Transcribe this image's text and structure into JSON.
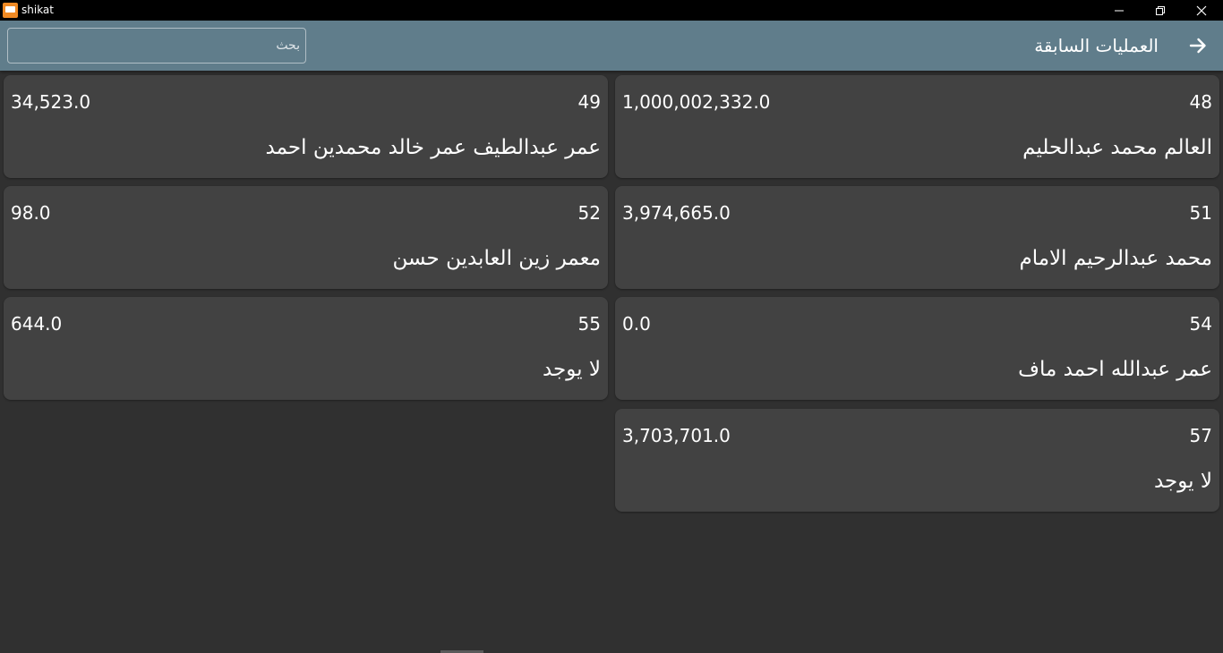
{
  "window": {
    "title": "shikat",
    "controls": [
      "minimize",
      "restore",
      "close"
    ]
  },
  "appbar": {
    "title": "العمليات السابقة",
    "back_icon": "arrow-right-icon",
    "search": {
      "placeholder": "بحث",
      "value": ""
    }
  },
  "colors": {
    "appbar": "#607d8b",
    "background": "#303030",
    "card": "#424242",
    "titlebar": "#000000"
  },
  "records": [
    {
      "id": "48",
      "amount": "1,000,002,332.0",
      "name": "العالم محمد عبدالحليم"
    },
    {
      "id": "49",
      "amount": "34,523.0",
      "name": "عمر عبدالطيف عمر خالد محمدين احمد"
    },
    {
      "id": "51",
      "amount": "3,974,665.0",
      "name": "محمد عبدالرحيم الامام"
    },
    {
      "id": "52",
      "amount": "98.0",
      "name": "معمر زين العابدين حسن"
    },
    {
      "id": "54",
      "amount": "0.0",
      "name": "عمر عبدالله احمد ماف"
    },
    {
      "id": "55",
      "amount": "644.0",
      "name": "لا يوجد"
    },
    {
      "id": "57",
      "amount": "3,703,701.0",
      "name": "لا يوجد"
    }
  ]
}
